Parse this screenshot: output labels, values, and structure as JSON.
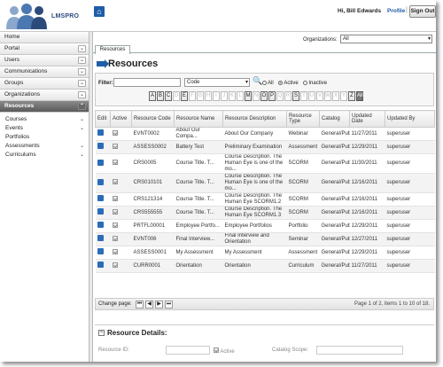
{
  "header": {
    "app_name": "LMSPRO",
    "greeting": "Hi, Bill Edwards",
    "separator": "|",
    "profile_label": "Profile",
    "signout_label": "Sign Out"
  },
  "sidebar": {
    "items": [
      {
        "label": "Home"
      },
      {
        "label": "Portal"
      },
      {
        "label": "Users"
      },
      {
        "label": "Communications"
      },
      {
        "label": "Groups"
      },
      {
        "label": "Organizations"
      },
      {
        "label": "Resources"
      }
    ],
    "subitems": [
      {
        "label": "Courses"
      },
      {
        "label": "Events"
      },
      {
        "label": "Portfolios"
      },
      {
        "label": "Assessments"
      },
      {
        "label": "Curriculums"
      }
    ]
  },
  "main": {
    "tab_label": "Resources",
    "org_label": "Organizations:",
    "org_value": "All",
    "page_title": "Resources"
  },
  "filter": {
    "label": "Filter:",
    "field_value": "Code",
    "radio_all": "All",
    "radio_active": "Active",
    "radio_inactive": "Inactive",
    "letters": [
      "A",
      "B",
      "C",
      "D",
      "E",
      "F",
      "G",
      "H",
      "I",
      "J",
      "K",
      "L",
      "M",
      "N",
      "O",
      "P",
      "Q",
      "R",
      "S",
      "T",
      "U",
      "V",
      "W",
      "X",
      "Y",
      "Z"
    ],
    "enabled_letters": [
      "A",
      "B",
      "C",
      "E",
      "M",
      "O",
      "P",
      "S",
      "Z"
    ],
    "all_label": "All"
  },
  "table": {
    "columns": [
      "Edit",
      "Active",
      "Resource Code",
      "Resource Name",
      "Resource Description",
      "Resource Type",
      "Catalog",
      "Updated Date",
      "Updated By"
    ],
    "rows": [
      {
        "code": "EVNT0002",
        "name": "About Our Compa...",
        "desc": "About Our Company",
        "type": "Webinar",
        "catalog": "General/Pub",
        "date": "11/27/2011",
        "by": "superuser"
      },
      {
        "code": "ASSESS0002",
        "name": "Battery Test",
        "desc": "Preliminary Examination",
        "type": "Assessment",
        "catalog": "General/Pub",
        "date": "12/29/2011",
        "by": "superuser"
      },
      {
        "code": "CRS0005",
        "name": "Course Title. T...",
        "desc": "Course Description. The Human Eye is one of the mo...",
        "type": "SCORM",
        "catalog": "General/Pub",
        "date": "11/30/2011",
        "by": "superuser"
      },
      {
        "code": "CRS010101",
        "name": "Course Title. T...",
        "desc": "Course Description. The Human Eye is one of the mo...",
        "type": "SCORM",
        "catalog": "General/Pub",
        "date": "12/16/2011",
        "by": "superuser"
      },
      {
        "code": "CRS121314",
        "name": "Course Title. T...",
        "desc": "Course Description. The Human Eye SCORM1.2",
        "type": "SCORM",
        "catalog": "General/Pub",
        "date": "12/16/2011",
        "by": "superuser"
      },
      {
        "code": "CRS555555",
        "name": "Course Title. T...",
        "desc": "Course Description. The Human Eye SCORM1.3",
        "type": "SCORM",
        "catalog": "General/Pub",
        "date": "12/16/2011",
        "by": "superuser"
      },
      {
        "code": "PRTFL00001",
        "name": "Employee Portfo...",
        "desc": "Employee Portfolios",
        "type": "Portfolio",
        "catalog": "General/Pub",
        "date": "12/29/2011",
        "by": "superuser"
      },
      {
        "code": "EVNT006",
        "name": "Final Interview...",
        "desc": "Final Interview and Orientation",
        "type": "Seminar",
        "catalog": "General/Pub",
        "date": "12/27/2011",
        "by": "superuser"
      },
      {
        "code": "ASSESS0001",
        "name": "My Assessment",
        "desc": "My Assessment",
        "type": "Assessment",
        "catalog": "General/Pub",
        "date": "12/29/2011",
        "by": "superuser"
      },
      {
        "code": "CURR0001",
        "name": "Orientation",
        "desc": "Orientation",
        "type": "Curriculum",
        "catalog": "General/Pub",
        "date": "11/27/2011",
        "by": "superuser"
      }
    ]
  },
  "pager": {
    "label": "Change page:",
    "info": "Page 1 of 2, items 1 to 10 of 18."
  },
  "details": {
    "title": "Resource Details:",
    "resource_id_label": "Resource ID:",
    "active_label": "Active",
    "catalog_scope_label": "Catalog Scope:"
  }
}
